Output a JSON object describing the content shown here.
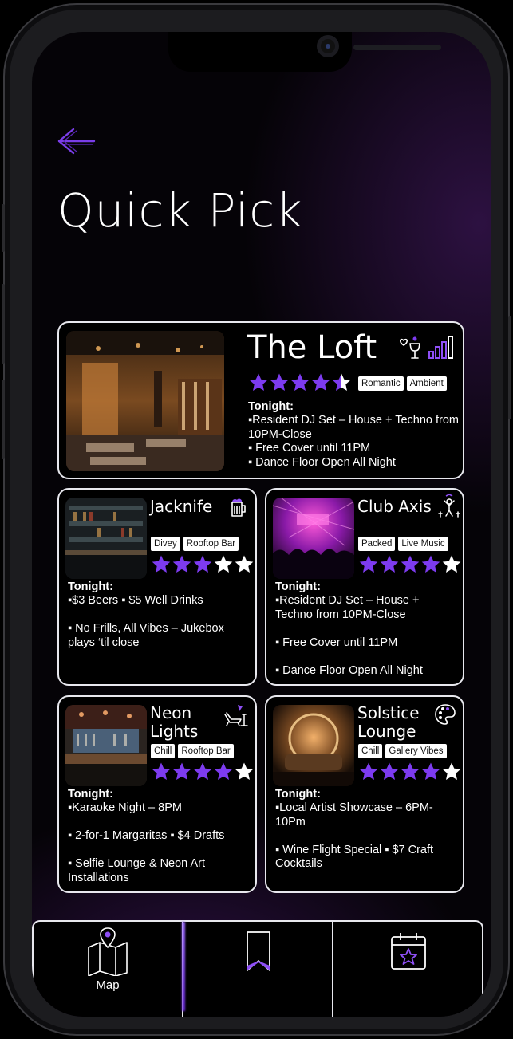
{
  "header": {
    "title": "Quick Pick"
  },
  "accent": "#7d3bf0",
  "venues": [
    {
      "name": "The Loft",
      "icons": [
        "wine-glass-heart-icon",
        "signal-bars-icon"
      ],
      "tags": [
        "Romantic",
        "Ambient"
      ],
      "rating": 4.5,
      "tonight_label": "Tonight:",
      "tonight": "▪Resident DJ Set – House + Techno from 10PM-Close\n▪ Free Cover until 11PM\n▪ Dance Floor Open All Night"
    },
    {
      "name": "Jacknife",
      "icons": [
        "beer-mug-icon"
      ],
      "tags": [
        "Divey",
        "Rooftop Bar"
      ],
      "rating": 3,
      "tonight_label": "Tonight:",
      "tonight": "▪$3 Beers  ▪ $5 Well Drinks\n\n▪ No Frills, All Vibes – Jukebox plays ‘til close"
    },
    {
      "name": "Club Axis",
      "icons": [
        "dancing-person-icon"
      ],
      "tags": [
        "Packed",
        "Live Music"
      ],
      "rating": 4,
      "tonight_label": "Tonight:",
      "tonight": "▪Resident DJ Set – House + Techno from 10PM-Close\n\n▪ Free Cover until 11PM\n\n▪ Dance Floor Open All Night"
    },
    {
      "name": "Neon Lights",
      "icons": [
        "lounge-chair-drink-icon"
      ],
      "tags": [
        "Chill",
        "Rooftop Bar"
      ],
      "rating": 4,
      "tonight_label": "Tonight:",
      "tonight": "▪Karaoke Night – 8PM\n\n▪ 2-for-1 Margaritas ▪ $4 Drafts\n\n▪ Selfie Lounge & Neon Art Installations"
    },
    {
      "name": "Solstice Lounge",
      "icons": [
        "paint-palette-icon"
      ],
      "tags": [
        "Chill",
        "Gallery Vibes"
      ],
      "rating": 4,
      "tonight_label": "Tonight:",
      "tonight": "▪Local Artist Showcase – 6PM-10Pm\n\n▪ Wine Flight Special ▪ $7 Craft Cocktails"
    }
  ],
  "tabbar": {
    "tabs": [
      {
        "label": "Map",
        "icon": "map-pin-icon"
      },
      {
        "label": "",
        "icon": "bookmark-icon"
      },
      {
        "label": "",
        "icon": "calendar-star-icon"
      }
    ]
  }
}
